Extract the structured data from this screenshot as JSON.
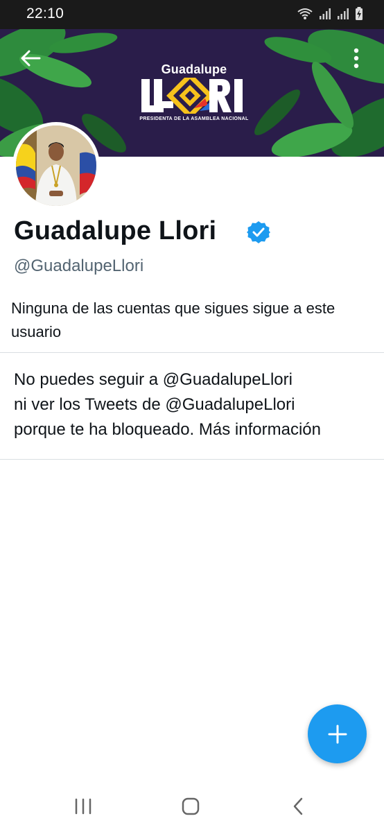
{
  "status_bar": {
    "time": "22:10",
    "icons": [
      "wifi-icon",
      "signal-icon",
      "signal-icon",
      "battery-charging-icon"
    ]
  },
  "banner": {
    "logo_top": "Guadalupe",
    "logo_main": "LLORI",
    "logo_subtitle": "PRESIDENTA DE LA ASAMBLEA NACIONAL",
    "background_color": "#2a1d4a",
    "back_icon": "arrow-left-icon",
    "more_icon": "more-vertical-icon"
  },
  "profile": {
    "display_name": "Guadalupe Llori",
    "verified_icon": "verified-badge-icon",
    "handle": "@GuadalupeLlori",
    "follow_note": "Ninguna de las cuentas que sigues sigue a este usuario"
  },
  "blocked": {
    "line1": "No puedes seguir a @GuadalupeLlori",
    "line2": "ni ver los Tweets de @GuadalupeLlori",
    "line3_prefix": "porque te ha bloqueado.",
    "link": "Más información"
  },
  "fab": {
    "icon": "plus-icon",
    "color": "#1d9bf0"
  },
  "nav": {
    "icons": [
      "recent-apps-icon",
      "home-icon",
      "back-icon"
    ]
  },
  "colors": {
    "accent": "#1d9bf0",
    "text": "#0f1419",
    "secondary": "#536471"
  }
}
